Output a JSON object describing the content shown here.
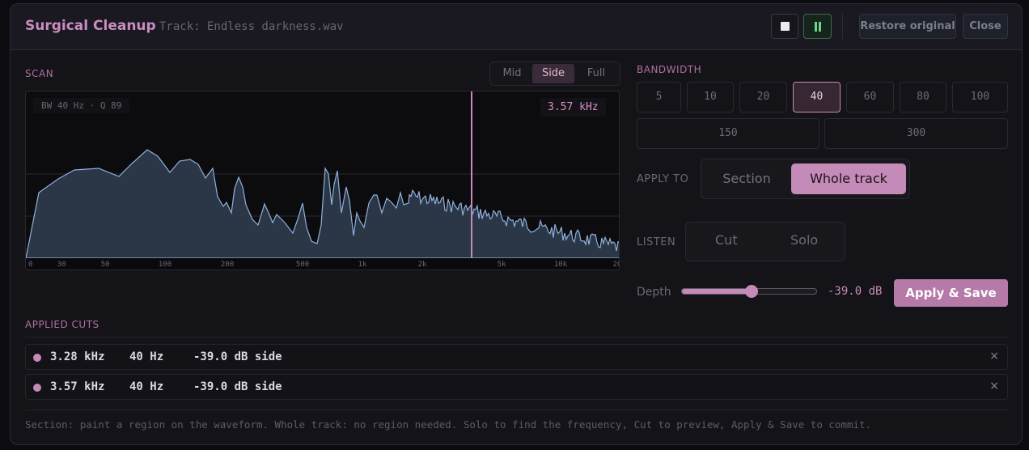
{
  "header": {
    "title": "Surgical Cleanup",
    "track": "Track: Endless darkness.wav",
    "restore_label": "Restore original",
    "close_label": "Close"
  },
  "scan": {
    "label": "SCAN",
    "modes": [
      "Mid",
      "Side",
      "Full"
    ],
    "active_mode": "Side",
    "bw_q": "BW 40 Hz · Q 89",
    "freq_readout": "3.57 kHz",
    "axis_ticks": [
      "0",
      "30",
      "50",
      "100",
      "200",
      "500",
      "1k",
      "2k",
      "5k",
      "10k",
      "20"
    ]
  },
  "bandwidth": {
    "label": "BANDWIDTH",
    "options": [
      "5",
      "10",
      "20",
      "40",
      "60",
      "80",
      "100",
      "150",
      "300"
    ],
    "active": "40"
  },
  "apply_to": {
    "label": "APPLY TO",
    "options": [
      "Section",
      "Whole track"
    ],
    "active": "Whole track"
  },
  "listen": {
    "label": "LISTEN",
    "options": [
      "Cut",
      "Solo"
    ]
  },
  "depth": {
    "label": "Depth",
    "value": "-39.0 dB",
    "level_fraction": 0.52
  },
  "apply_save_label": "Apply & Save",
  "applied_cuts": {
    "label": "APPLIED CUTS",
    "rows": [
      {
        "freq": "3.28 kHz",
        "bw": "40 Hz",
        "depth": "-39.0 dB side",
        "remove": "×"
      },
      {
        "freq": "3.57 kHz",
        "bw": "40 Hz",
        "depth": "-39.0 dB side",
        "remove": "×"
      }
    ]
  },
  "footer": "Section: paint a region on the waveform. Whole track: no region needed. Solo to find the frequency, Cut to preview, Apply & Save to commit.",
  "colors": {
    "accent": "#c48ab8",
    "spectrum_fill": "#2b3746",
    "spectrum_line": "#8fb2de",
    "playing_green": "#6ed58a"
  }
}
